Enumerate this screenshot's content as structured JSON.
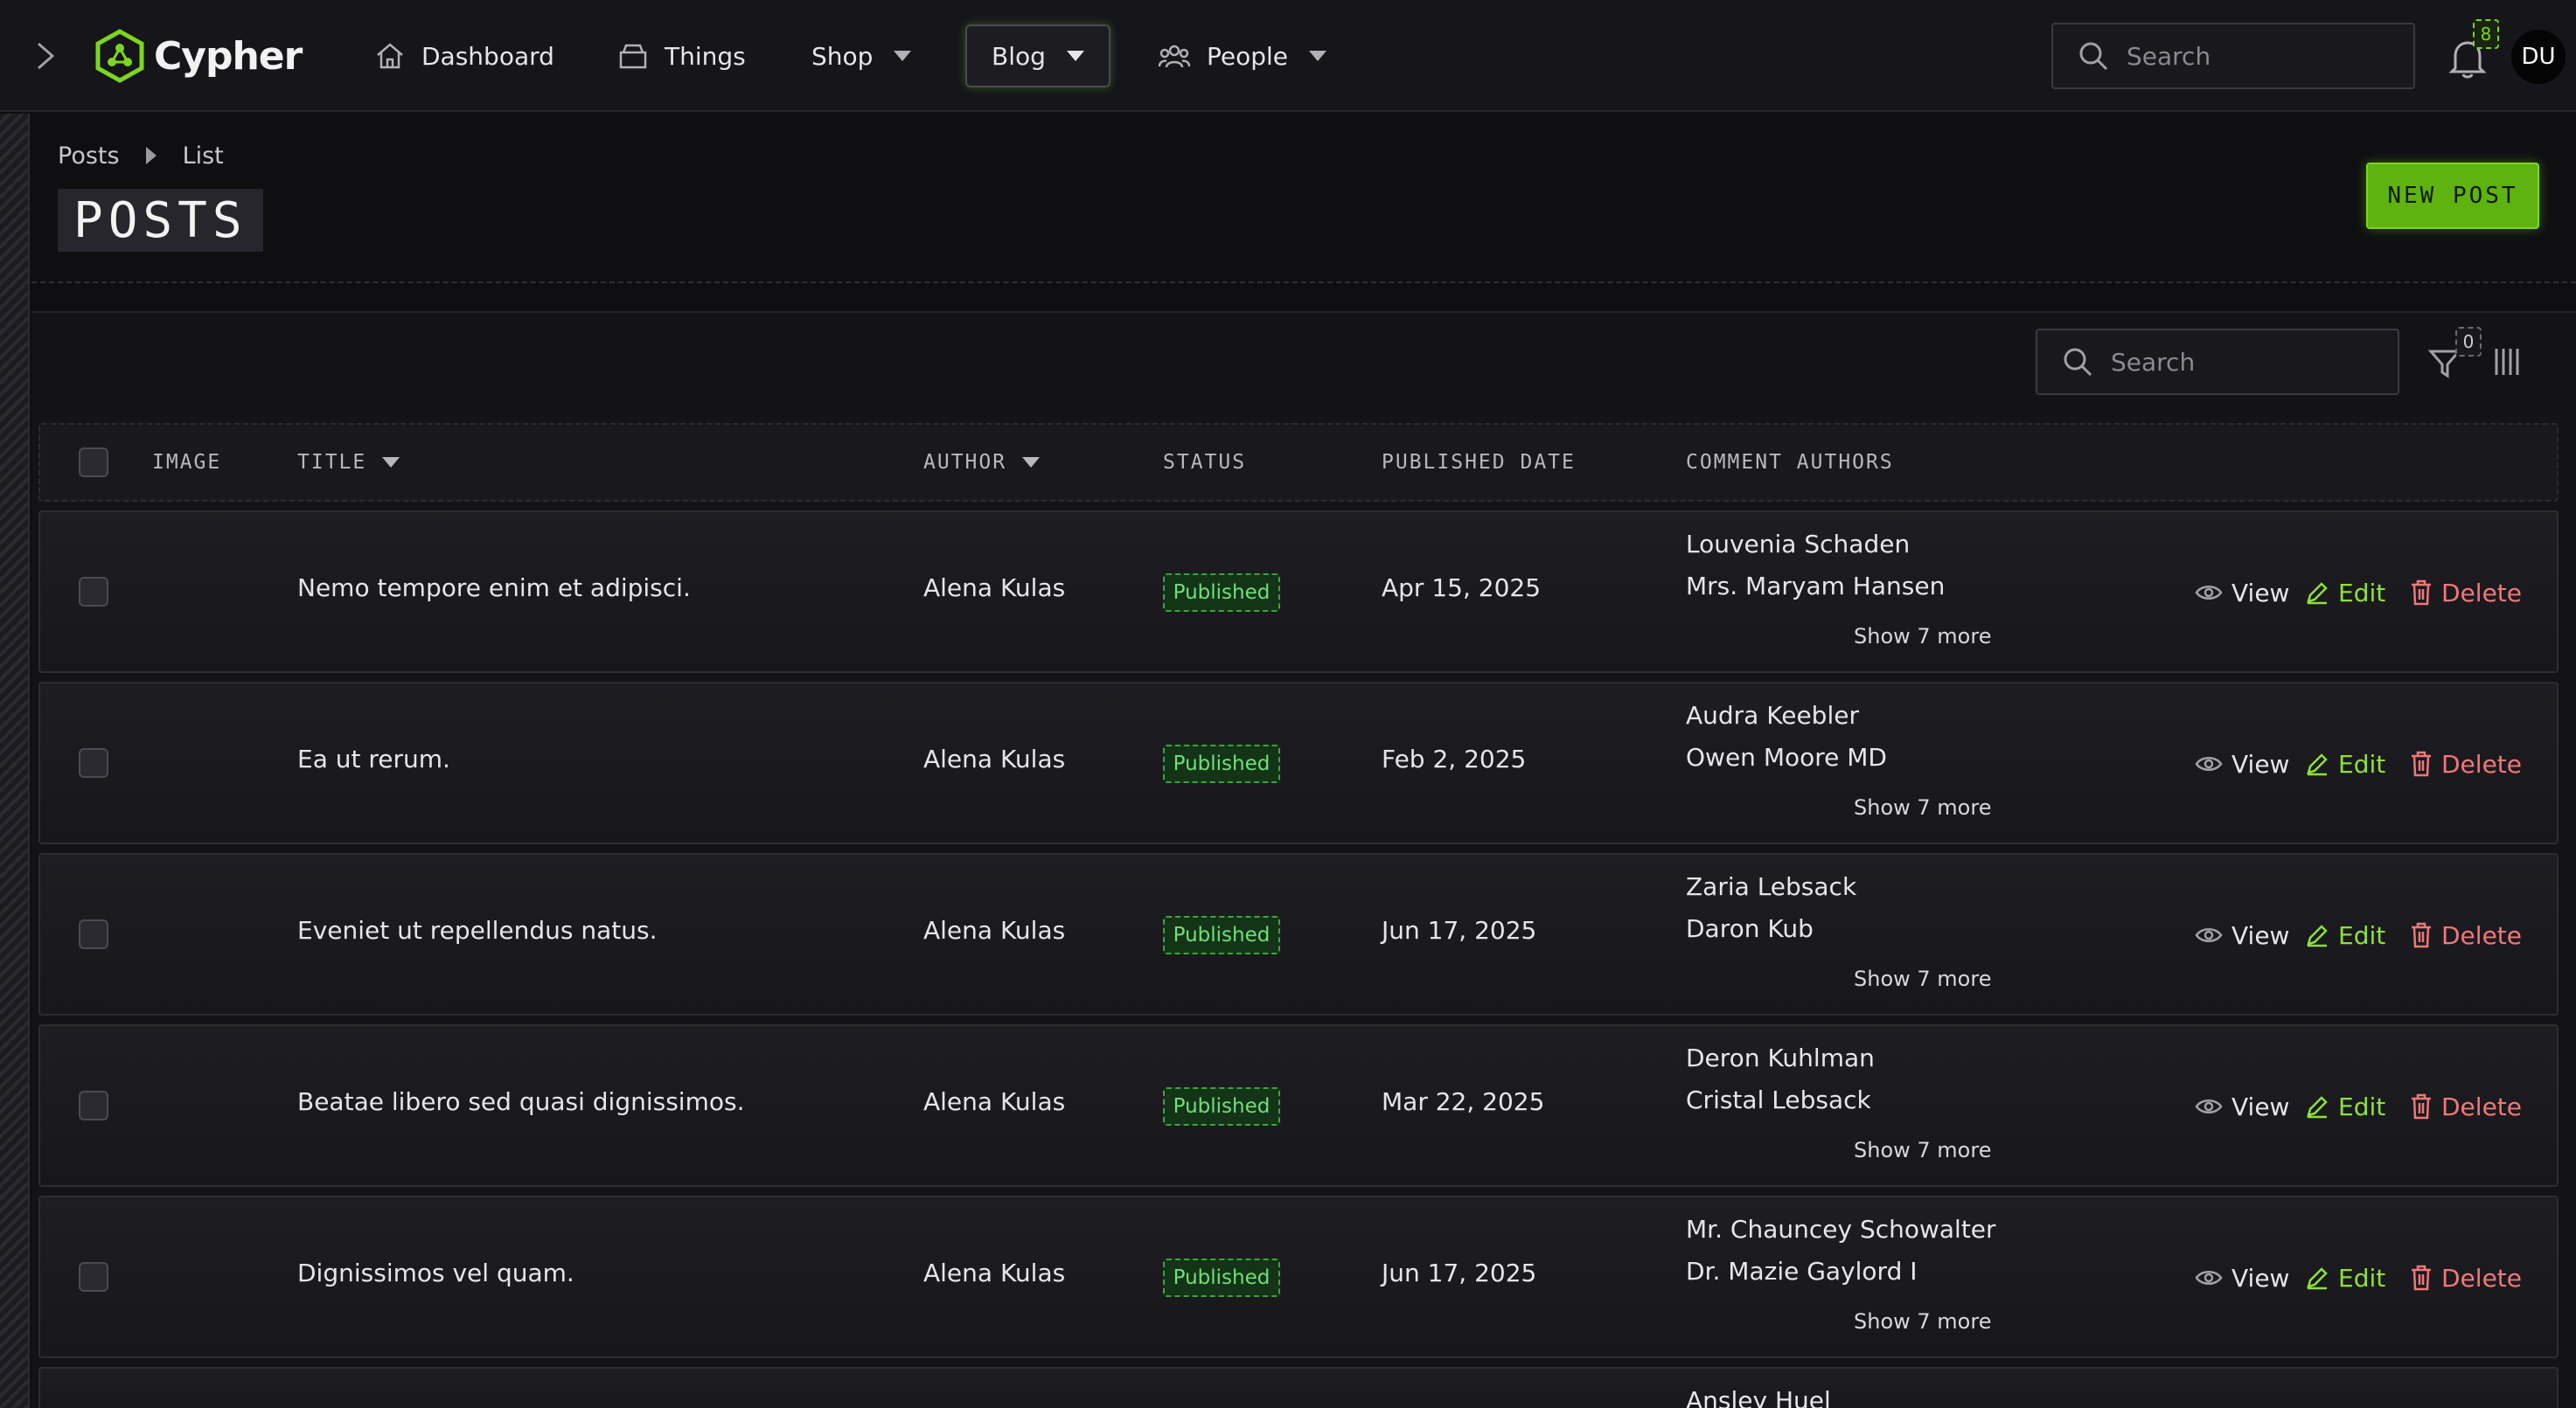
{
  "nav": {
    "brand": "Cypher",
    "items": [
      {
        "label": "Dashboard"
      },
      {
        "label": "Things"
      },
      {
        "label": "Shop"
      },
      {
        "label": "Blog"
      },
      {
        "label": "People"
      }
    ],
    "search_placeholder": "Search",
    "notifications_count": "8",
    "avatar_initials": "DU"
  },
  "page": {
    "breadcrumb": [
      "Posts",
      "List"
    ],
    "title": "POSTS",
    "new_post_label": "NEW POST"
  },
  "toolbar": {
    "search_placeholder": "Search",
    "filter_count": "0"
  },
  "table": {
    "headers": {
      "image": "IMAGE",
      "title": "TITLE",
      "author": "AUTHOR",
      "status": "STATUS",
      "published_date": "PUBLISHED DATE",
      "comment_authors": "COMMENT AUTHORS"
    },
    "actions": {
      "view": "View",
      "edit": "Edit",
      "delete": "Delete"
    },
    "rows": [
      {
        "title": "Nemo tempore enim et adipisci.",
        "author": "Alena Kulas",
        "status": "Published",
        "date": "Apr 15, 2025",
        "comment_authors": [
          "Louvenia Schaden",
          "Mrs. Maryam Hansen"
        ],
        "more": "Show 7 more"
      },
      {
        "title": "Ea ut rerum.",
        "author": "Alena Kulas",
        "status": "Published",
        "date": "Feb 2, 2025",
        "comment_authors": [
          "Audra Keebler",
          "Owen Moore MD"
        ],
        "more": "Show 7 more"
      },
      {
        "title": "Eveniet ut repellendus natus.",
        "author": "Alena Kulas",
        "status": "Published",
        "date": "Jun 17, 2025",
        "comment_authors": [
          "Zaria Lebsack",
          "Daron Kub"
        ],
        "more": "Show 7 more"
      },
      {
        "title": "Beatae libero sed quasi dignissimos.",
        "author": "Alena Kulas",
        "status": "Published",
        "date": "Mar 22, 2025",
        "comment_authors": [
          "Deron Kuhlman",
          "Cristal Lebsack"
        ],
        "more": "Show 7 more"
      },
      {
        "title": "Dignissimos vel quam.",
        "author": "Alena Kulas",
        "status": "Published",
        "date": "Jun 17, 2025",
        "comment_authors": [
          "Mr. Chauncey Schowalter",
          "Dr. Mazie Gaylord I"
        ],
        "more": "Show 7 more"
      },
      {
        "comment_authors": [
          "Ansley Huel"
        ]
      }
    ]
  },
  "colors": {
    "accent": "#7cd620",
    "published": "#6fe07a",
    "delete": "#f07878",
    "background": "#0f0f12"
  }
}
